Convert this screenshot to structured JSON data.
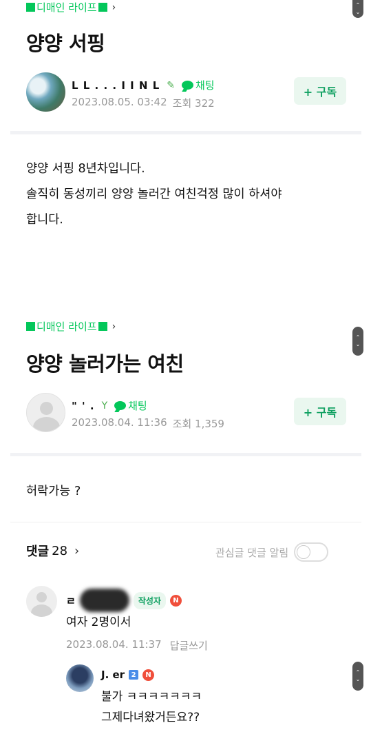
{
  "posts": [
    {
      "board": "디매인 라이프",
      "title": "양양 서핑",
      "author_visible": "L L . . . I I N L",
      "chat_label": "채팅",
      "date": "2023.08.05. 03:42",
      "views_label": "조회 322",
      "subscribe_label": "+ 구독",
      "body_lines": [
        "양양 서핑 8년차입니다.",
        "솔직히 동성끼리 양양 놀러간 여친걱정 많이 하셔야",
        "합니다."
      ]
    },
    {
      "board": "디매인 라이프",
      "title": "양양 놀러가는 여친",
      "author_visible": "\" ' .",
      "chat_label": "채팅",
      "date": "2023.08.04. 11:36",
      "views_label": "조회 1,359",
      "subscribe_label": "+ 구독",
      "body_lines": [
        "허락가능 ?"
      ]
    }
  ],
  "comments_section": {
    "label": "댓글",
    "count": "28",
    "notify_label": "관심글 댓글 알림",
    "notify_on": false
  },
  "comments": [
    {
      "author_visible": "ㄹ",
      "writer_badge": "작성자",
      "n_badge": "N",
      "text": "여자 2명이서",
      "date": "2023.08.04. 11:37",
      "reply_label": "답글쓰기"
    },
    {
      "author_visible": "J.        er",
      "level_badge": "2",
      "n_badge": "N",
      "text_lines": [
        "불가 ㅋㅋㅋㅋㅋㅋㅋ",
        "그제다녀왔거든요??"
      ]
    }
  ],
  "icons": {
    "chevron": "›",
    "sprout": "sprout-icon",
    "chat": "chat-bubble-icon"
  },
  "colors": {
    "brand_green": "#03c75a",
    "subscribe_bg": "#eaf7ef",
    "new_badge": "#f04f3b"
  }
}
